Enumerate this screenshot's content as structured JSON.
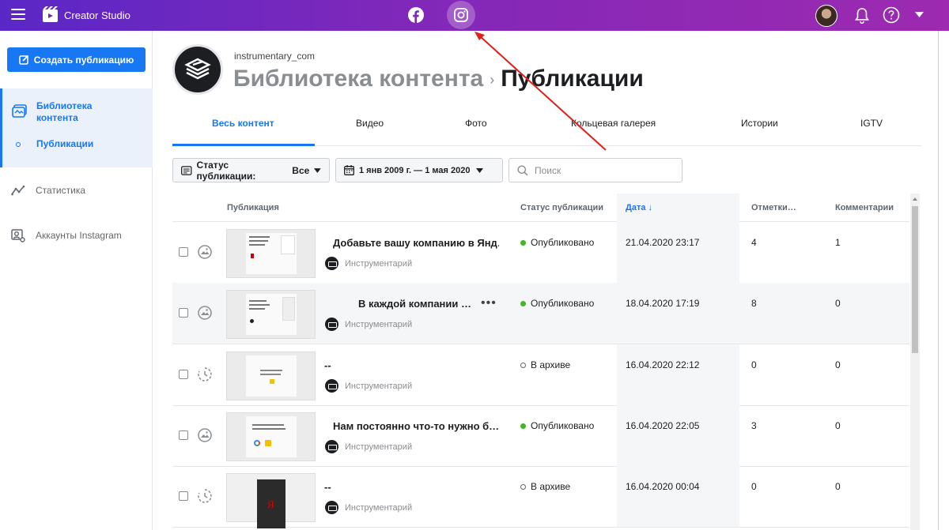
{
  "topbar": {
    "app_name": "Creator Studio",
    "icons": [
      "menu-icon",
      "creator-studio-logo",
      "facebook-icon",
      "instagram-icon",
      "avatar",
      "bell-icon",
      "help-icon",
      "chevron-down-icon"
    ]
  },
  "sidebar": {
    "create_button": "Создать публикацию",
    "library": "Библиотека контента",
    "publications": "Публикации",
    "stats": "Статистика",
    "accounts": "Аккаунты Instagram"
  },
  "account": {
    "name": "instrumentary_com"
  },
  "breadcrumb": {
    "library": "Библиотека контента",
    "separator": "›",
    "current": "Публикации"
  },
  "tabs": [
    "Весь контент",
    "Видео",
    "Фото",
    "Кольцевая галерея",
    "Истории",
    "IGTV"
  ],
  "filters": {
    "status_label": "Статус публикации:",
    "status_value": "Все",
    "date_range": "1 янв 2009 г. — 1 мая 2020 г",
    "search_placeholder": "Поиск"
  },
  "table": {
    "headers": {
      "publication": "Публикация",
      "status": "Статус публикации",
      "date": "Дата ↓",
      "tags": "Отметки…",
      "comments": "Комментарии"
    },
    "rows": [
      {
        "title": "Добавьте вашу компанию в Янд…",
        "author": "Инструментарий",
        "status": "Опубликовано",
        "status_type": "published",
        "date": "21.04.2020 23:17",
        "tags": "4",
        "comments": "1",
        "type": "photo"
      },
      {
        "title": "В каждой компании …",
        "author": "Инструментарий",
        "status": "Опубликовано",
        "status_type": "published",
        "date": "18.04.2020 17:19",
        "tags": "8",
        "comments": "0",
        "type": "photo"
      },
      {
        "title": "--",
        "author": "Инструментарий",
        "status": "В архиве",
        "status_type": "archived",
        "date": "16.04.2020 22:12",
        "tags": "0",
        "comments": "0",
        "type": "story"
      },
      {
        "title": "Нам постоянно что-то нужно б…",
        "author": "Инструментарий",
        "status": "Опубликовано",
        "status_type": "published",
        "date": "16.04.2020 22:05",
        "tags": "3",
        "comments": "0",
        "type": "photo"
      },
      {
        "title": "--",
        "author": "Инструментарий",
        "status": "В архиве",
        "status_type": "archived",
        "date": "16.04.2020 00:04",
        "tags": "0",
        "comments": "0",
        "type": "story"
      }
    ]
  },
  "colors": {
    "topbar_start": "#5a27c7",
    "topbar_end": "#9d2ab0",
    "accent": "#1877f2",
    "published": "#42b72a",
    "annotation_arrow": "#e0201b"
  }
}
